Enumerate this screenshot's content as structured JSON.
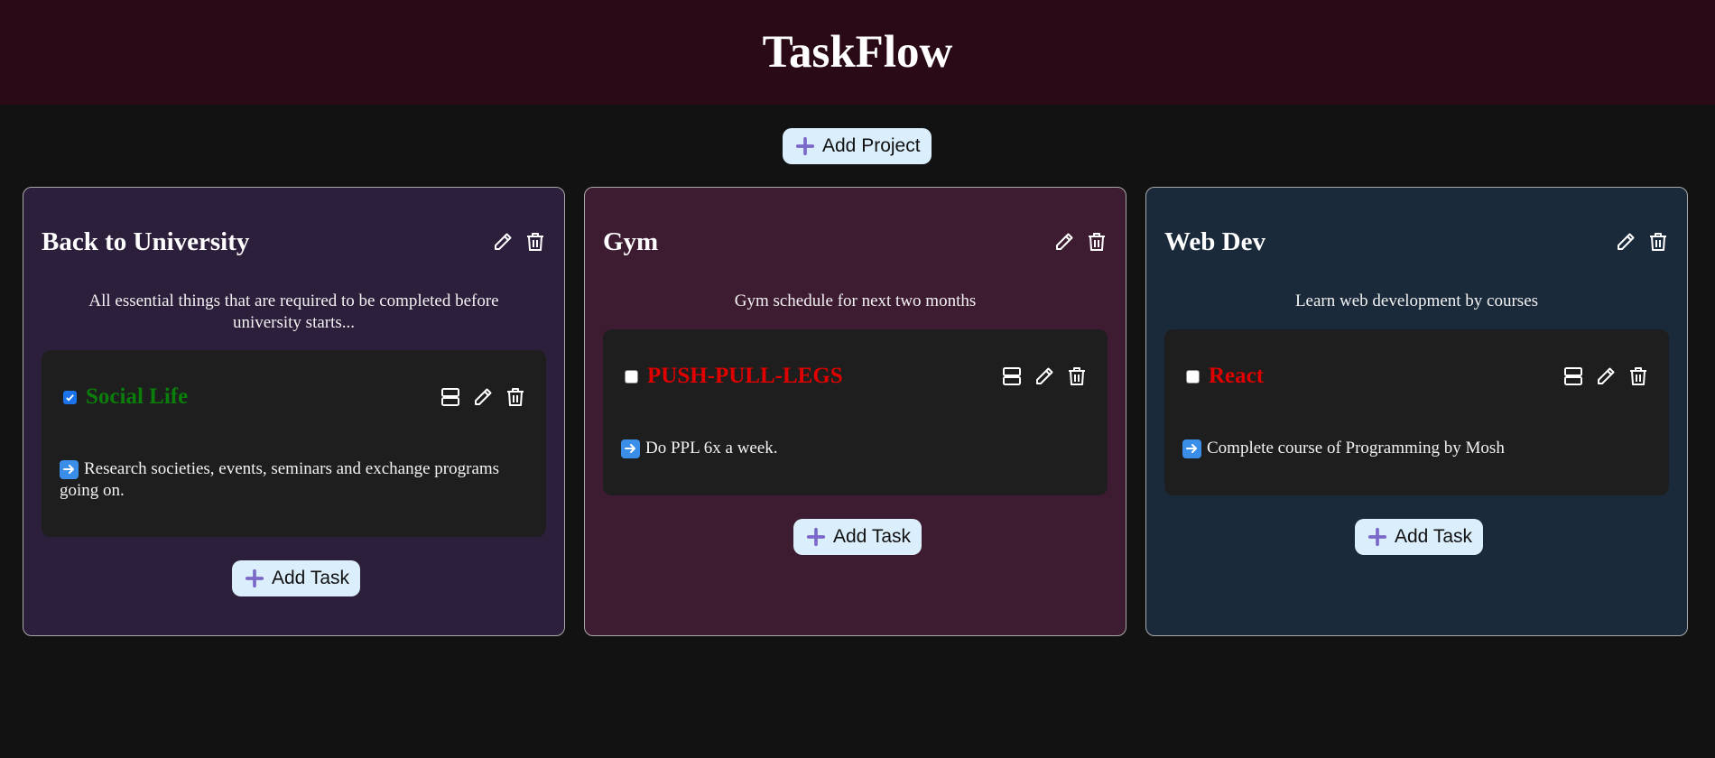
{
  "app": {
    "title": "TaskFlow",
    "add_project_label": "Add Project",
    "colors": {
      "header_bg": "#2b0a17",
      "page_bg": "#121212",
      "button_bg": "#dbeefc",
      "plus_icon": "#7b68c8",
      "completed_title": "#0a7d0a",
      "pending_title": "#e00000"
    }
  },
  "projects": [
    {
      "title": "Back to University",
      "description": "All essential things that are required to be completed before university starts...",
      "bg": "#2c1f3b",
      "add_task_label": "Add Task",
      "tasks": [
        {
          "title": "Social Life",
          "checked": true,
          "description": "Research societies, events, seminars and exchange programs going on."
        }
      ]
    },
    {
      "title": "Gym",
      "description": "Gym schedule for next two months",
      "bg": "#3d1c31",
      "add_task_label": "Add Task",
      "tasks": [
        {
          "title": "PUSH-PULL-LEGS",
          "checked": false,
          "description": "Do PPL 6x a week."
        }
      ]
    },
    {
      "title": "Web Dev",
      "description": "Learn web development by courses",
      "bg": "#1b2a3b",
      "add_task_label": "Add Task",
      "tasks": [
        {
          "title": "React",
          "checked": false,
          "description": "Complete course of Programming by Mosh"
        }
      ]
    }
  ]
}
